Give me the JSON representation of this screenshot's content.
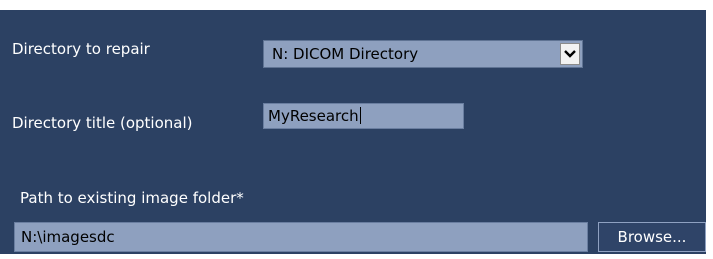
{
  "form": {
    "directory_to_repair_label": "Directory to repair",
    "directory_to_repair_value": "N: DICOM Directory",
    "directory_title_label": "Directory title (optional)",
    "directory_title_value": "MyResearch",
    "image_folder_label": "Path to existing image folder*",
    "image_folder_value": "N:\\imagesdc",
    "browse_label": "Browse..."
  },
  "icons": {
    "dropdown": "chevron-down-icon",
    "dropdown_glyph": "⌄"
  },
  "colors": {
    "panel_bg": "#2c4163",
    "field_bg": "#8ea0bf",
    "text": "#ffffff"
  }
}
